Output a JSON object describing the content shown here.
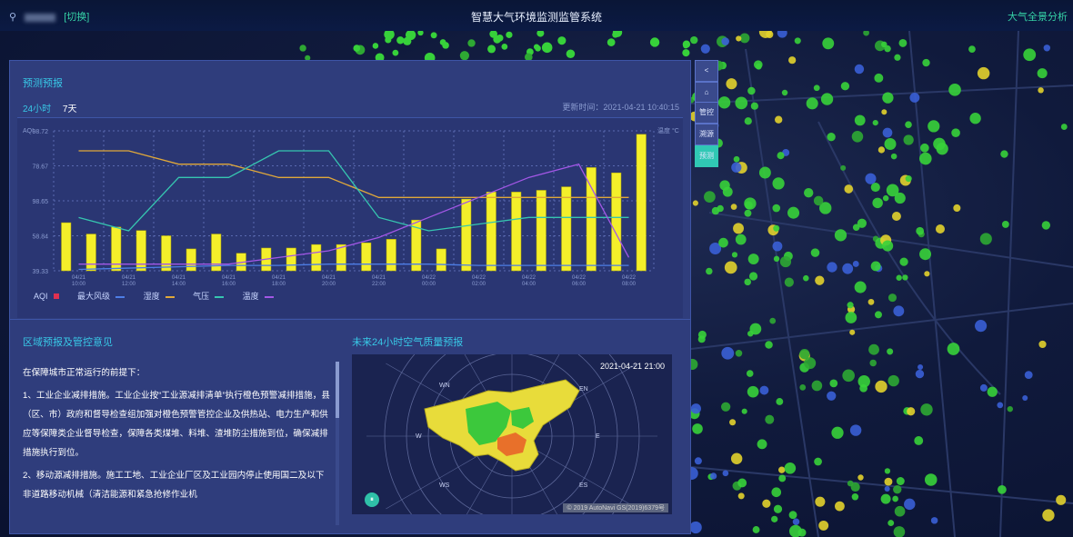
{
  "header": {
    "switch_label": "[切换]",
    "title": "智慧大气环境监测监管系统",
    "right_label": "大气全景分析"
  },
  "map": {
    "search_placeholder": ""
  },
  "side_controls": [
    "<",
    "⌂",
    "管控",
    "溯源",
    "预测"
  ],
  "panel": {
    "title": "预测预报",
    "tabs": [
      "24小时",
      "7天"
    ],
    "update_time": "更新时间：2021-04-21 10:40:15",
    "legend": [
      "AQI",
      "最大风级",
      "湿度",
      "气压",
      "温度"
    ]
  },
  "chart_data": {
    "type": "bar",
    "y_left_ticks": [
      "39.33",
      "58.84",
      "98.65",
      "78.67",
      "98.72"
    ],
    "y_left_label": "AQI",
    "y_right_label": "温度 °C",
    "x": [
      "04/21 10:00",
      "04/21 12:00",
      "04/21 14:00",
      "04/21 16:00",
      "04/21 18:00",
      "04/21 20:00",
      "04/21 22:00",
      "04/22 00:00",
      "04/22 02:00",
      "04/22 04:00",
      "04/22 06:00",
      "04/22 08:00"
    ],
    "aqi": [
      55,
      42,
      50,
      46,
      40,
      25,
      42,
      20,
      26,
      26,
      30,
      30,
      32,
      36,
      58,
      25,
      82,
      90,
      90,
      92,
      96,
      118,
      112,
      156
    ],
    "series": [
      {
        "name": "最大风级",
        "color": "#4d7ee6",
        "values": [
          1,
          2,
          3,
          4,
          4,
          5,
          5,
          5,
          4,
          4,
          4,
          4
        ]
      },
      {
        "name": "湿度",
        "color": "#e0a83a",
        "values": [
          90,
          90,
          80,
          80,
          70,
          70,
          55,
          55,
          55,
          55,
          55,
          55
        ]
      },
      {
        "name": "气压",
        "color": "#36c6b0",
        "values": [
          40,
          30,
          70,
          70,
          90,
          90,
          40,
          30,
          35,
          40,
          40,
          40
        ]
      },
      {
        "name": "温度",
        "color": "#a357e6",
        "values": [
          5,
          5,
          5,
          5,
          10,
          15,
          25,
          40,
          55,
          70,
          80,
          10
        ]
      }
    ]
  },
  "lower": {
    "left_title": "区域预报及管控意见",
    "right_title": "未来24小时空气质量预报",
    "paragraphs": [
      "在保障城市正常运行的前提下：",
      "1、工业企业减排措施。工业企业按“工业源减排清单”执行橙色预警减排措施，县（区、市）政府和督导检查组加强对橙色预警管控企业及供热站、电力生产和供应等保障类企业督导检查，保障各类煤堆、料堆、渣堆防尘措施到位，确保减排措施执行到位。",
      "2、移动源减排措施。施工工地、工业企业厂区及工业园内停止使用国二及以下非道路移动机械（清洁能源和紧急抢修作业机"
    ],
    "forecast_time": "2021-04-21 21:00",
    "compass": [
      "WN",
      "EN",
      "W",
      "E",
      "WS",
      "ES"
    ]
  }
}
